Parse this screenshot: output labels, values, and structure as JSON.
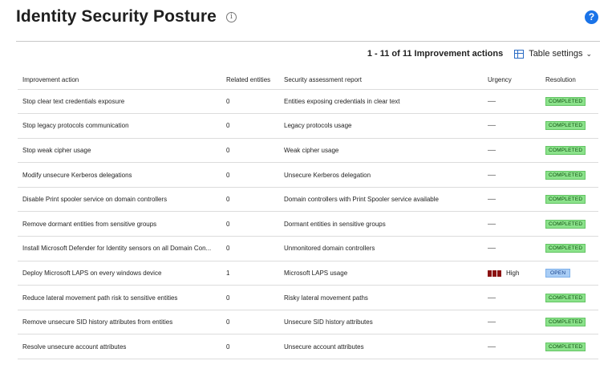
{
  "page": {
    "title": "Identity Security Posture",
    "info_icon": "info-icon",
    "help_icon": "?"
  },
  "toolbar": {
    "count_text": "1 - 11 of 11 Improvement actions",
    "table_settings_label": "Table settings"
  },
  "table": {
    "headers": [
      "Improvement action",
      "Related entities",
      "Security assessment report",
      "Urgency",
      "Resolution"
    ],
    "rows": [
      {
        "action": "Stop clear text credentials exposure",
        "entities": "0",
        "report": "Entities exposing credentials in clear text",
        "urgency": "—",
        "resolution": "COMPLETED"
      },
      {
        "action": "Stop legacy protocols communication",
        "entities": "0",
        "report": "Legacy protocols usage",
        "urgency": "—",
        "resolution": "COMPLETED"
      },
      {
        "action": "Stop weak cipher usage",
        "entities": "0",
        "report": "Weak cipher usage",
        "urgency": "—",
        "resolution": "COMPLETED"
      },
      {
        "action": "Modify unsecure Kerberos delegations",
        "entities": "0",
        "report": "Unsecure Kerberos delegation",
        "urgency": "—",
        "resolution": "COMPLETED"
      },
      {
        "action": "Disable Print spooler service on domain controllers",
        "entities": "0",
        "report": "Domain controllers with Print Spooler service available",
        "urgency": "—",
        "resolution": "COMPLETED"
      },
      {
        "action": "Remove dormant entities from sensitive groups",
        "entities": "0",
        "report": "Dormant entities in sensitive groups",
        "urgency": "—",
        "resolution": "COMPLETED"
      },
      {
        "action": "Install Microsoft Defender for Identity sensors on all Domain Con...",
        "entities": "0",
        "report": "Unmonitored domain controllers",
        "urgency": "—",
        "resolution": "COMPLETED"
      },
      {
        "action": "Deploy Microsoft LAPS on every windows device",
        "entities": "1",
        "report": "Microsoft LAPS usage",
        "urgency": "High",
        "urgency_level": 3,
        "resolution": "OPEN"
      },
      {
        "action": "Reduce lateral movement path risk to sensitive entities",
        "entities": "0",
        "report": "Risky lateral movement paths",
        "urgency": "—",
        "resolution": "COMPLETED"
      },
      {
        "action": "Remove unsecure SID history attributes from entities",
        "entities": "0",
        "report": "Unsecure SID history attributes",
        "urgency": "—",
        "resolution": "COMPLETED"
      },
      {
        "action": "Resolve unsecure account attributes",
        "entities": "0",
        "report": "Unsecure account attributes",
        "urgency": "—",
        "resolution": "COMPLETED"
      }
    ]
  },
  "colors": {
    "completed_badge": "#8be28b",
    "open_badge": "#a9cdf5",
    "urgency_high": "#8b1212",
    "accent": "#1a73e8"
  }
}
